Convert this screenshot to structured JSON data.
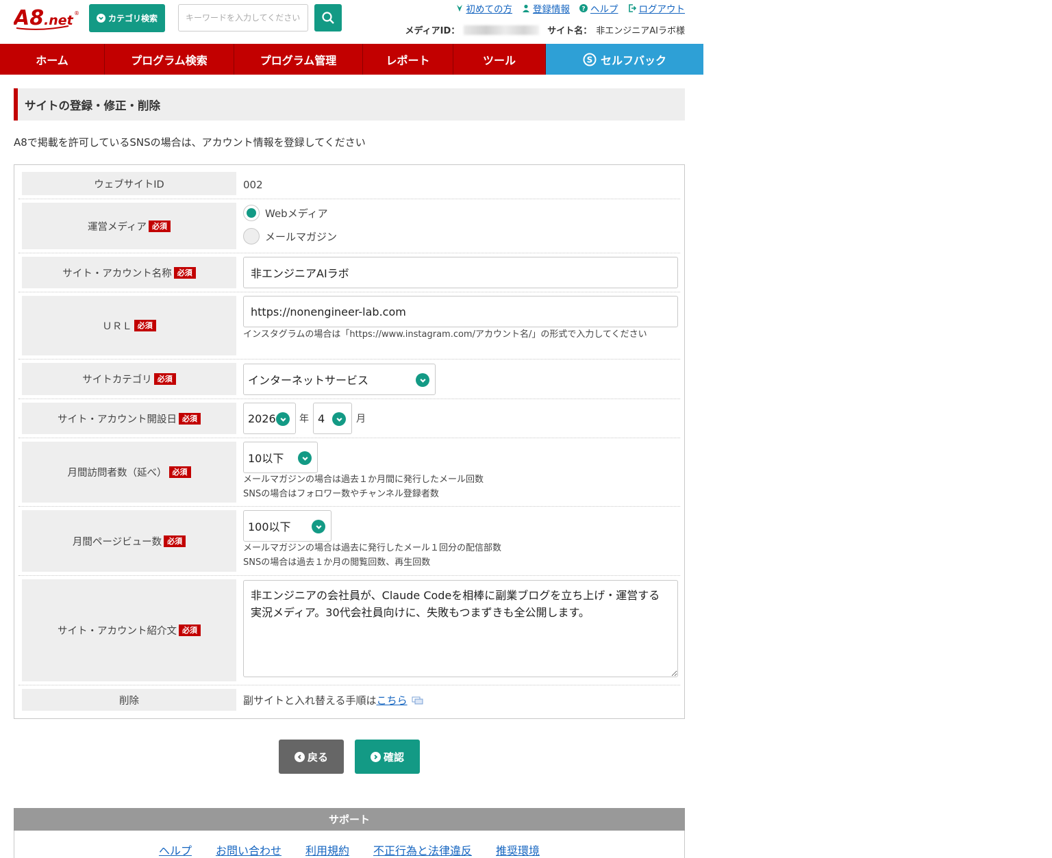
{
  "header": {
    "logo_text": "A8.net",
    "category_button": "カテゴリ検索",
    "search_placeholder": "キーワードを入力してください",
    "links": [
      "初めての方",
      "登録情報",
      "ヘルプ",
      "ログアウト"
    ],
    "media_id_label": "メディアID：",
    "site_name_label": "サイト名：",
    "site_name_value": "非エンジニアAIラボ様"
  },
  "nav": {
    "items": [
      "ホーム",
      "プログラム検索",
      "プログラム管理",
      "レポート",
      "ツール"
    ],
    "selfback": "セルフバック"
  },
  "page": {
    "title": "サイトの登録・修正・削除",
    "intro": "A8で掲載を許可しているSNSの場合は、アカウント情報を登録してください"
  },
  "form": {
    "required_badge": "必須",
    "website_id": {
      "label": "ウェブサイトID",
      "value": "002"
    },
    "media": {
      "label": "運営メディア",
      "options": [
        "Webメディア",
        "メールマガジン"
      ],
      "selected": "Webメディア"
    },
    "site_name": {
      "label": "サイト・アカウント名称",
      "value": "非エンジニアAIラボ"
    },
    "url": {
      "label": "ＵＲＬ",
      "value": "https://nonengineer-lab.com",
      "help": "インスタグラムの場合は「https://www.instagram.com/アカウント名/」の形式で入力してください"
    },
    "category": {
      "label": "サイトカテゴリ",
      "value": "インターネットサービス"
    },
    "open_date": {
      "label": "サイト・アカウント開設日",
      "year": "2026",
      "year_unit": "年",
      "month": "4",
      "month_unit": "月"
    },
    "visitors": {
      "label": "月間訪問者数（延べ）",
      "value": "10以下",
      "help1": "メールマガジンの場合は過去１か月間に発行したメール回数",
      "help2": "SNSの場合はフォロワー数やチャンネル登録者数"
    },
    "pageviews": {
      "label": "月間ページビュー数",
      "value": "100以下",
      "help1": "メールマガジンの場合は過去に発行したメール１回分の配信部数",
      "help2": "SNSの場合は過去１か月の閲覧回数、再生回数"
    },
    "intro_text": {
      "label": "サイト・アカウント紹介文",
      "value": "非エンジニアの会社員が、Claude Codeを相棒に副業ブログを立ち上げ・運営する実況メディア。30代会社員向けに、失敗もつまずきも全公開します。"
    },
    "delete": {
      "label": "削除",
      "text": "副サイトと入れ替える手順は",
      "link": "こちら"
    }
  },
  "buttons": {
    "back": "戻る",
    "confirm": "確認"
  },
  "support": {
    "title": "サポート",
    "links": [
      "ヘルプ",
      "お問い合わせ",
      "利用規約",
      "不正行為と法律違反",
      "推奨環境"
    ]
  },
  "colors": {
    "brand_red": "#c20000",
    "accent_green": "#139a85",
    "selfback_blue": "#2ea0d6",
    "link_blue": "#1565c0"
  }
}
